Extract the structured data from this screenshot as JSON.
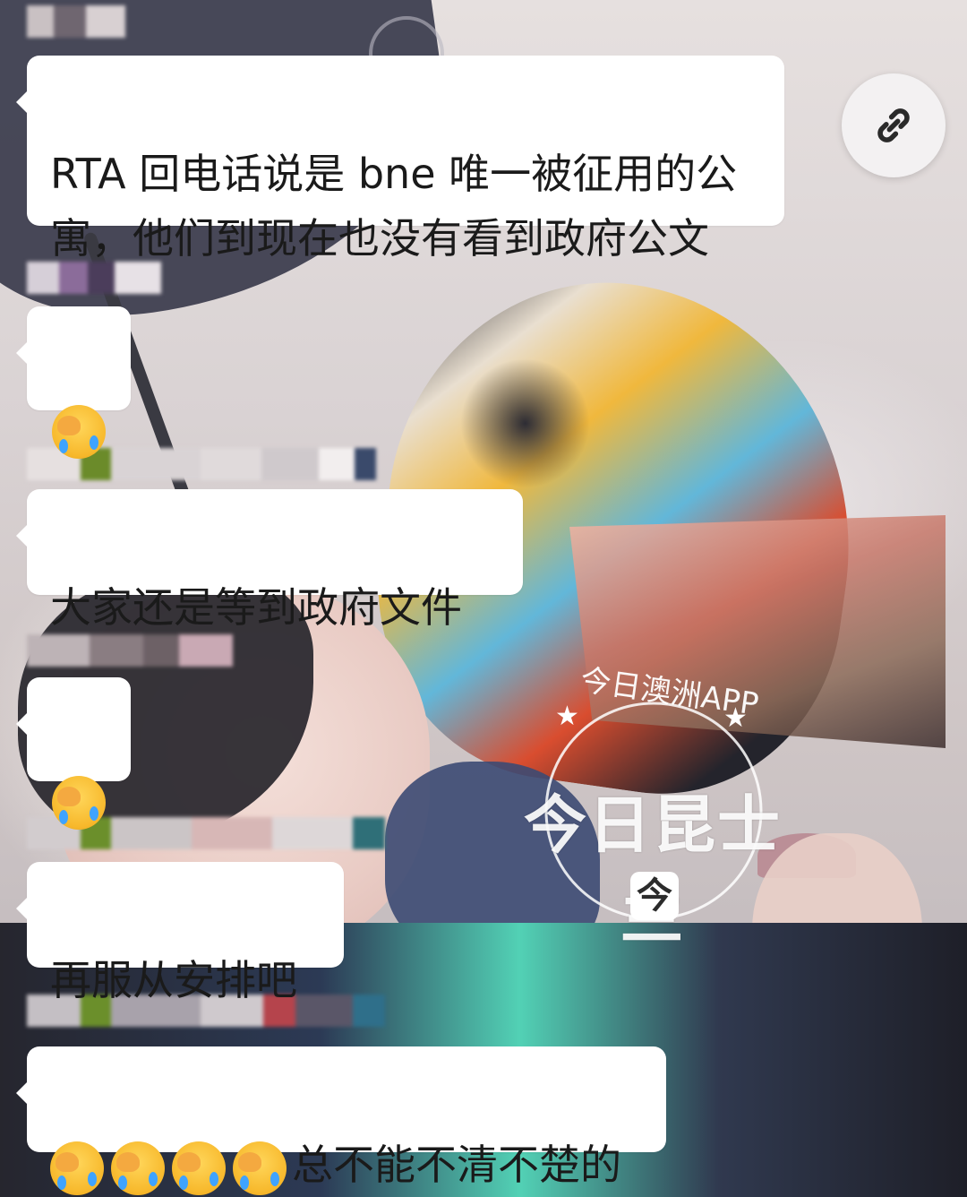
{
  "messages": [
    {
      "text": "RTA 回电话说是 bne 唯一被征用的公\n寓，他们到现在也没有看到政府公文"
    },
    {
      "emoji_count": 1
    },
    {
      "text": "大家还是等到政府文件"
    },
    {
      "emoji_count": 1
    },
    {
      "text": "再服从安排吧"
    },
    {
      "emoji_count": 4,
      "text": "总不能不清不楚的"
    }
  ],
  "icons": {
    "link": "link-icon",
    "emoji": "face-with-tears-covering-eyes"
  },
  "watermark": {
    "main": "今日昆士兰",
    "sub": "今日澳洲APP",
    "mark": "今"
  },
  "colors": {
    "bubble": "#ffffff",
    "text": "#1a1a1a"
  }
}
